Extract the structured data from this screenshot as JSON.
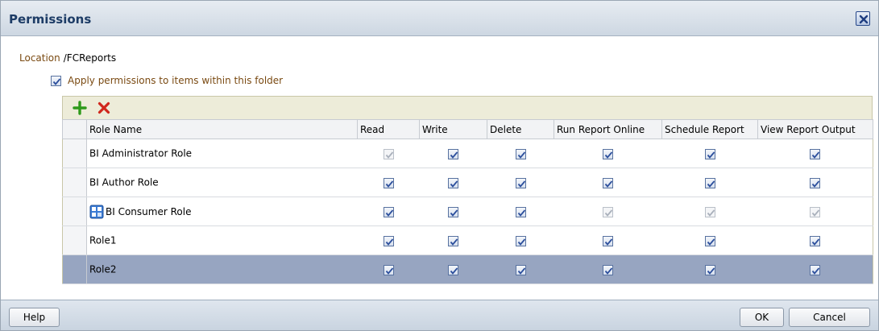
{
  "dialog": {
    "title": "Permissions",
    "close_icon": "close-icon"
  },
  "location": {
    "label": "Location",
    "value": "/FCReports"
  },
  "apply": {
    "label": "Apply permissions to items within this folder",
    "checked": true
  },
  "toolbar": {
    "add_icon": "add-icon",
    "delete_icon": "delete-icon"
  },
  "table": {
    "columns": [
      "Role Name",
      "Read",
      "Write",
      "Delete",
      "Run Report Online",
      "Schedule Report",
      "View Report Output"
    ],
    "rows": [
      {
        "name": "BI Administrator Role",
        "icon": "",
        "selected": false,
        "perms": [
          {
            "checked": true,
            "disabled": true
          },
          {
            "checked": true,
            "disabled": false
          },
          {
            "checked": true,
            "disabled": false
          },
          {
            "checked": true,
            "disabled": false
          },
          {
            "checked": true,
            "disabled": false
          },
          {
            "checked": true,
            "disabled": false
          }
        ]
      },
      {
        "name": "BI Author Role",
        "icon": "",
        "selected": false,
        "perms": [
          {
            "checked": true,
            "disabled": false
          },
          {
            "checked": true,
            "disabled": false
          },
          {
            "checked": true,
            "disabled": false
          },
          {
            "checked": true,
            "disabled": false
          },
          {
            "checked": true,
            "disabled": false
          },
          {
            "checked": true,
            "disabled": false
          }
        ]
      },
      {
        "name": "BI Consumer Role",
        "icon": "role-group-icon",
        "selected": false,
        "perms": [
          {
            "checked": true,
            "disabled": false
          },
          {
            "checked": true,
            "disabled": false
          },
          {
            "checked": true,
            "disabled": false
          },
          {
            "checked": true,
            "disabled": true
          },
          {
            "checked": true,
            "disabled": true
          },
          {
            "checked": true,
            "disabled": true
          }
        ]
      },
      {
        "name": "Role1",
        "icon": "",
        "selected": false,
        "perms": [
          {
            "checked": true,
            "disabled": false
          },
          {
            "checked": true,
            "disabled": false
          },
          {
            "checked": true,
            "disabled": false
          },
          {
            "checked": true,
            "disabled": false
          },
          {
            "checked": true,
            "disabled": false
          },
          {
            "checked": true,
            "disabled": false
          }
        ]
      },
      {
        "name": "Role2",
        "icon": "",
        "selected": true,
        "perms": [
          {
            "checked": true,
            "disabled": false
          },
          {
            "checked": true,
            "disabled": false
          },
          {
            "checked": true,
            "disabled": false
          },
          {
            "checked": true,
            "disabled": false
          },
          {
            "checked": true,
            "disabled": false
          },
          {
            "checked": true,
            "disabled": false
          }
        ]
      }
    ]
  },
  "footer": {
    "help_label": "Help",
    "ok_label": "OK",
    "cancel_label": "Cancel"
  },
  "colors": {
    "title_text": "#1d3c66",
    "label_text": "#7a4a12",
    "selected_row": "#97a5c1",
    "check": "#2b4e9c",
    "add": "#2e9a1a",
    "delete": "#d0271c"
  }
}
